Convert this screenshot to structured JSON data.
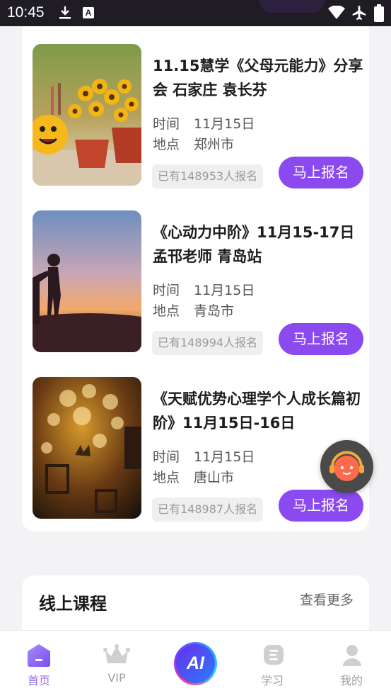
{
  "status_bar": {
    "time": "10:45",
    "a_badge": "A"
  },
  "events": [
    {
      "title": "11.15慧学《父母元能力》分享会 石家庄 袁长芬",
      "time_label": "时间",
      "time_value": "11月15日",
      "place_label": "地点",
      "place_value": "郑州市",
      "count": "已有148953人报名",
      "signup": "马上报名"
    },
    {
      "title": "《心动力中阶》11月15-17日孟邗老师 青岛站",
      "time_label": "时间",
      "time_value": "11月15日",
      "place_label": "地点",
      "place_value": "青岛市",
      "count": "已有148994人报名",
      "signup": "马上报名"
    },
    {
      "title": "《天赋优势心理学个人成长篇初阶》11月15日-16日",
      "time_label": "时间",
      "time_value": "11月15日",
      "place_label": "地点",
      "place_value": "唐山市",
      "count": "已有148987人报名",
      "signup": "马上报名"
    }
  ],
  "online": {
    "heading": "线上课程",
    "more": "查看更多"
  },
  "tabbar": {
    "home": "首页",
    "vip": "VIP",
    "ai": "AI",
    "study": "学习",
    "mine": "我的"
  },
  "colors": {
    "accent": "#8b4af0",
    "active_tab": "#9a70e8"
  }
}
